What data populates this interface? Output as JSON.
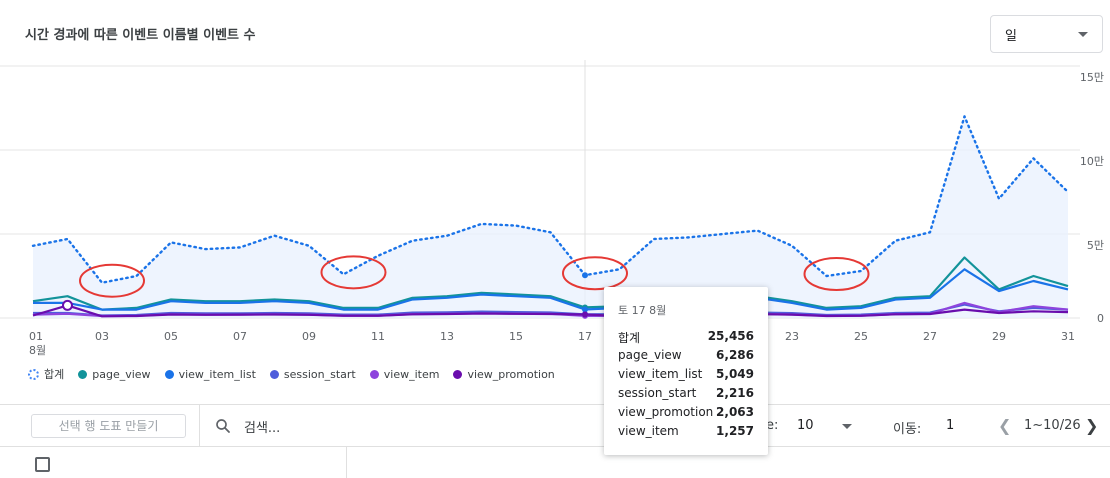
{
  "title": "시간 경과에 따른 이벤트 이름별 이벤트 수",
  "period_select": {
    "value": "일"
  },
  "chart_data": {
    "type": "line",
    "x": [
      "01",
      "02",
      "03",
      "04",
      "05",
      "06",
      "07",
      "08",
      "09",
      "10",
      "11",
      "12",
      "13",
      "14",
      "15",
      "16",
      "17",
      "18",
      "19",
      "20",
      "21",
      "22",
      "23",
      "24",
      "25",
      "26",
      "27",
      "28",
      "29",
      "30",
      "31"
    ],
    "x_ticks": [
      "01",
      "03",
      "05",
      "07",
      "09",
      "11",
      "13",
      "15",
      "17",
      "19",
      "21",
      "23",
      "25",
      "27",
      "29",
      "31"
    ],
    "x_month_label": "8월",
    "ylim": [
      0,
      150000
    ],
    "y_ticks": [
      {
        "value": 0,
        "label": "0"
      },
      {
        "value": 50000,
        "label": "5만"
      },
      {
        "value": 100000,
        "label": "10만"
      },
      {
        "value": 150000,
        "label": "15만"
      }
    ],
    "series": [
      {
        "name": "합계",
        "color": "#1a73e8",
        "style": "dotted",
        "area": true,
        "values": [
          43000,
          47000,
          21000,
          25000,
          45000,
          41000,
          42000,
          49000,
          43000,
          26000,
          37000,
          46000,
          49000,
          56000,
          55000,
          51000,
          25456,
          29000,
          47000,
          48000,
          50000,
          52000,
          43000,
          25000,
          28000,
          46000,
          51000,
          120000,
          71000,
          95000,
          75000
        ]
      },
      {
        "name": "page_view",
        "color": "#12939a",
        "style": "solid",
        "values": [
          10000,
          13000,
          5000,
          6000,
          11000,
          10000,
          10000,
          11000,
          10000,
          6000,
          6000,
          12000,
          13000,
          15000,
          14000,
          13000,
          6286,
          7000,
          11000,
          11000,
          12000,
          13000,
          10000,
          6000,
          7000,
          12000,
          13000,
          36000,
          17000,
          25000,
          19000
        ]
      },
      {
        "name": "view_item_list",
        "color": "#1a73e8",
        "style": "solid",
        "values": [
          9000,
          9000,
          5000,
          5000,
          10000,
          9000,
          9000,
          10000,
          9000,
          5000,
          5000,
          11000,
          12000,
          14000,
          13000,
          12000,
          5049,
          6000,
          10000,
          10000,
          11000,
          12000,
          9000,
          5000,
          6000,
          11000,
          12000,
          29000,
          16000,
          22000,
          17000
        ]
      },
      {
        "name": "session_start",
        "color": "#4f5ddb",
        "style": "solid",
        "values": [
          3000,
          3000,
          1500,
          1800,
          3000,
          2800,
          2800,
          3000,
          2800,
          2000,
          2000,
          3200,
          3400,
          3800,
          3500,
          3300,
          2216,
          2300,
          3000,
          3000,
          3100,
          3300,
          2900,
          1800,
          2000,
          3000,
          3200,
          8000,
          4000,
          6000,
          5000
        ]
      },
      {
        "name": "view_item",
        "color": "#8e44dd",
        "style": "solid",
        "values": [
          2000,
          2500,
          1200,
          1300,
          2200,
          2000,
          2000,
          2200,
          2000,
          1400,
          1400,
          2300,
          2500,
          2800,
          2600,
          2500,
          1257,
          1300,
          2200,
          2200,
          2300,
          2400,
          2100,
          1300,
          1400,
          2300,
          2500,
          9000,
          3500,
          7000,
          5000
        ]
      },
      {
        "name": "view_promotion",
        "color": "#6a0dad",
        "style": "solid",
        "values": [
          1500,
          7500,
          1000,
          1200,
          2100,
          1900,
          2000,
          2100,
          1900,
          1300,
          1300,
          2200,
          2400,
          2700,
          2500,
          2400,
          2063,
          1200,
          2100,
          2100,
          2200,
          2300,
          2000,
          1200,
          1300,
          2200,
          2400,
          5000,
          3000,
          4000,
          3500
        ]
      }
    ],
    "annotations": [
      {
        "shape": "ellipse",
        "color": "#e53935",
        "at_x": "03"
      },
      {
        "shape": "ellipse",
        "color": "#e53935",
        "at_x": "10"
      },
      {
        "shape": "ellipse",
        "color": "#e53935",
        "at_x": "17"
      },
      {
        "shape": "ellipse",
        "color": "#e53935",
        "at_x": "24"
      }
    ],
    "hover_x": "17"
  },
  "legend": [
    {
      "label": "합계",
      "color": "#4285f4",
      "dashed": true
    },
    {
      "label": "page_view",
      "color": "#12939a"
    },
    {
      "label": "view_item_list",
      "color": "#1a73e8"
    },
    {
      "label": "session_start",
      "color": "#4f5ddb"
    },
    {
      "label": "view_item",
      "color": "#8e44dd"
    },
    {
      "label": "view_promotion",
      "color": "#6a0dad"
    }
  ],
  "tooltip": {
    "date": "토 17 8월",
    "rows": [
      {
        "name": "합계",
        "value": "25,456"
      },
      {
        "name": "page_view",
        "value": "6,286"
      },
      {
        "name": "view_item_list",
        "value": "5,049"
      },
      {
        "name": "session_start",
        "value": "2,216"
      },
      {
        "name": "view_promotion",
        "value": "2,063"
      },
      {
        "name": "view_item",
        "value": "1,257"
      }
    ]
  },
  "toolbar": {
    "make_graph_label": "선택 행 도표 만들기",
    "search_label": "검색...",
    "rows_partial": "e:",
    "rows_per_page": "10",
    "goto_label": "이동:",
    "goto_value": "1",
    "page_range": "1~10/26",
    "prev_icon": "chevron-left-icon",
    "next_icon": "chevron-right-icon"
  }
}
